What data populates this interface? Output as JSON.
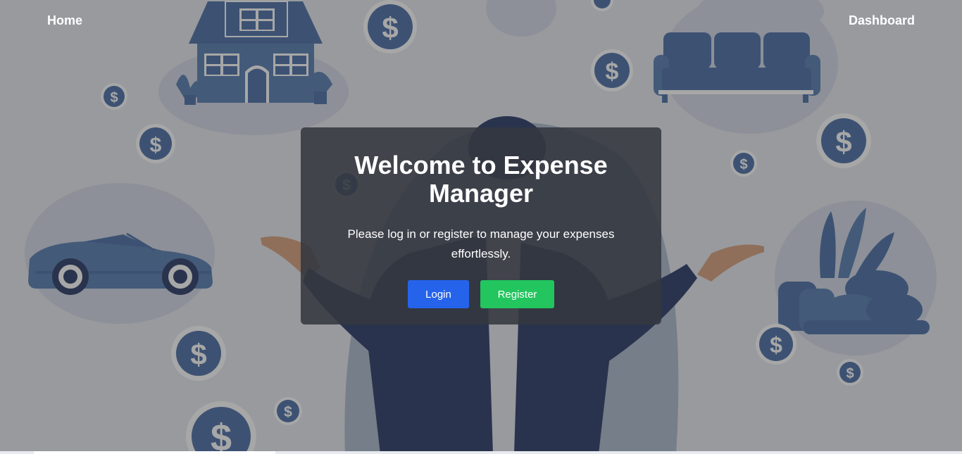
{
  "nav": {
    "home_label": "Home",
    "dashboard_label": "Dashboard"
  },
  "hero": {
    "title": "Welcome to Expense Manager",
    "subtitle": "Please log in or register to manage your expenses effortlessly.",
    "login_label": "Login",
    "register_label": "Register"
  },
  "icons": {
    "coin_symbol": "$"
  },
  "colors": {
    "login_button": "#2563eb",
    "register_button": "#22c55e",
    "illustration_blue": "#3f65a0",
    "illustration_navy": "#1b2d5c",
    "card_background": "rgba(52,56,64,0.88)"
  }
}
